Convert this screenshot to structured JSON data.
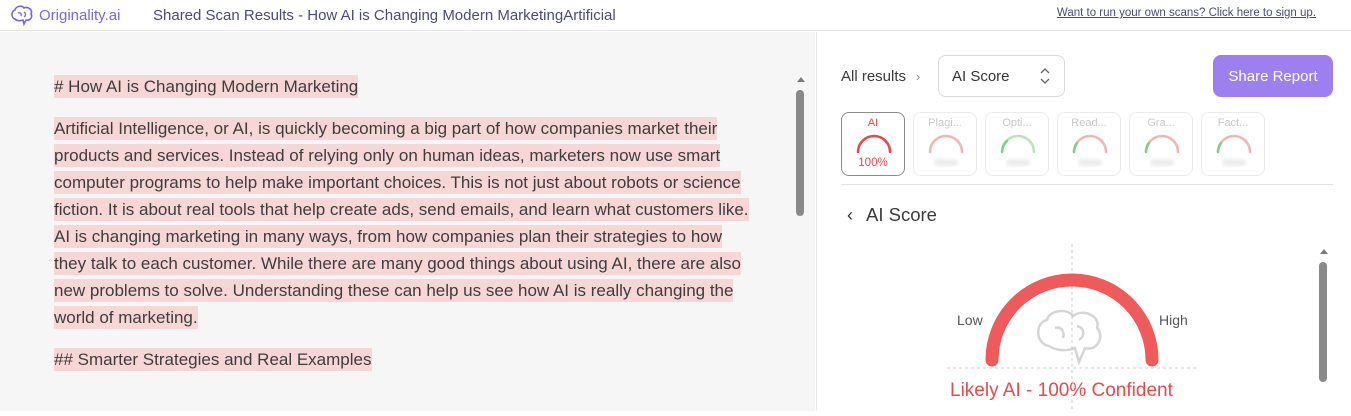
{
  "header": {
    "brand": "Originality.ai",
    "title": "Shared Scan Results - How AI is Changing Modern MarketingArtificial",
    "signup_link": "Want to run your own scans? Click here to sign up."
  },
  "document": {
    "paragraphs": [
      "# How AI is Changing Modern Marketing",
      "Artificial Intelligence, or AI, is quickly becoming a big part of how companies market their products and services. Instead of relying only on human ideas, marketers now use smart computer programs to help make important choices. This is not just about robots or science fiction. It is about real tools that help create ads, send emails, and learn what customers like. AI is changing marketing in many ways, from how companies plan their strategies to how they talk to each customer. While there are many good things about using AI, there are also new problems to solve. Understanding these can help us see how AI is really changing the world of marketing.",
      "## Smarter Strategies and Real Examples"
    ]
  },
  "panel": {
    "all_results_label": "All results",
    "select_value": "AI Score",
    "share_button": "Share Report",
    "tabs": [
      {
        "label": "AI",
        "value": "100%",
        "active": true,
        "gauge_color": "#e5484d"
      },
      {
        "label": "Plagi...",
        "value": "",
        "active": false,
        "gauge_color": "#f3b4b4"
      },
      {
        "label": "Opti...",
        "value": "",
        "active": false,
        "gauge_color": "#b9e2bd"
      },
      {
        "label": "Read...",
        "value": "",
        "active": false,
        "gauge_color": "#f3b4b4"
      },
      {
        "label": "Gra...",
        "value": "",
        "active": false,
        "gauge_color": "#f3b4b4"
      },
      {
        "label": "Fact...",
        "value": "",
        "active": false,
        "gauge_color": "#f3b4b4"
      }
    ],
    "section_title": "AI Score",
    "gauge": {
      "low_label": "Low",
      "high_label": "High",
      "value_fraction": 1.0,
      "color": "#ef5a5a"
    },
    "verdict": "Likely AI - 100% Confident"
  }
}
